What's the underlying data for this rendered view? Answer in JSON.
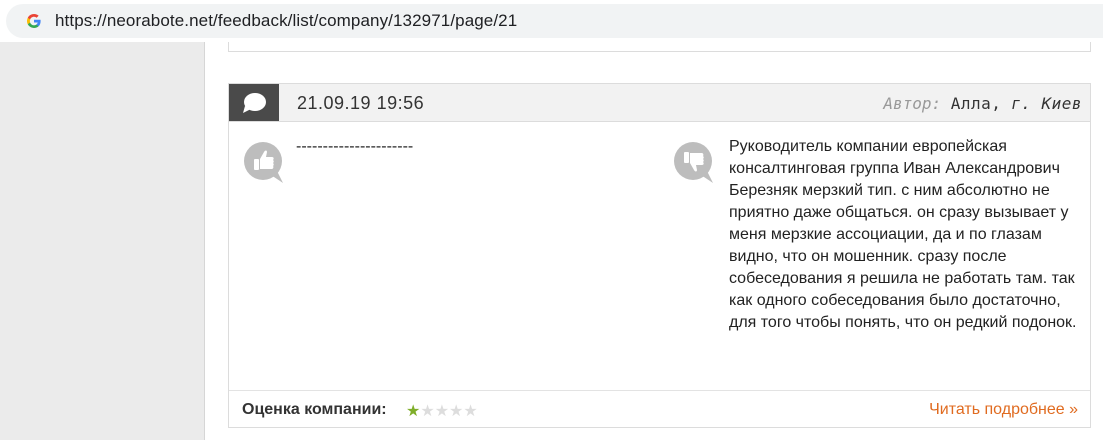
{
  "browser": {
    "url": "https://neorabote.net/feedback/list/company/132971/page/21",
    "favicon": "google-g-icon"
  },
  "review": {
    "date": "21.09.19 19:56",
    "author_label": "Автор:",
    "author_name": "Алла,",
    "author_city": "г. Киев",
    "pros_icon": "thumbs-up-icon",
    "pros_text": "----------------------",
    "cons_icon": "thumbs-down-icon",
    "cons_text": "Руководитель компании европейская консалтинговая группа Иван Александрович Березняк мерзкий тип. с ним абсолютно не приятно даже общаться. он сразу вызывает у меня мерзкие ассоциации, да и по глазам видно, что он мошенник. сразу после собеседования я решила не работать там. так как одного собеседования было достаточно, для того чтобы понять, что он редкий подонок.",
    "rating_label": "Оценка компании:",
    "rating": 1,
    "rating_max": 5,
    "read_more": "Читать подробнее »"
  },
  "colors": {
    "accent_link": "#e06b20",
    "star_on": "#7fae2a",
    "star_off": "#dddddd",
    "header_dark": "#4a4a4a"
  }
}
